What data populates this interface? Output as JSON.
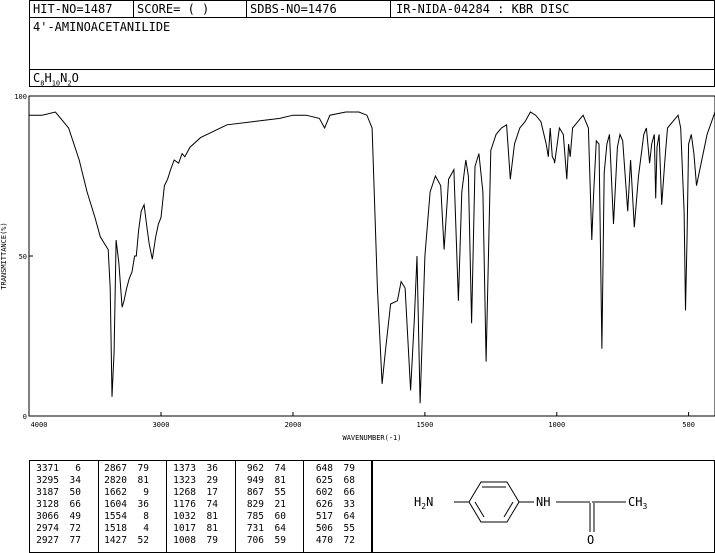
{
  "header": {
    "hit_no": "HIT-NO=1487",
    "score": "SCORE=  (   )",
    "sdbs_no": "SDBS-NO=1476",
    "ir_nida": "IR-NIDA-04284 : KBR DISC",
    "compound_name": "4'-AMINOACETANILIDE",
    "formula": "C8H10N2O"
  },
  "chart_data": {
    "type": "line",
    "title": "",
    "xlabel": "WAVENUMBER(-1)",
    "ylabel": "TRANSMITTANCE(%)",
    "xlim": [
      4000,
      400
    ],
    "ylim": [
      0,
      100
    ],
    "x_ticks": [
      "4000",
      "3000",
      "2000",
      "1500",
      "1000",
      "500"
    ],
    "y_ticks": [
      "100",
      "50",
      "0"
    ],
    "series": [
      {
        "x": [
          4000,
          3900,
          3800,
          3700,
          3620,
          3560,
          3500,
          3460,
          3430,
          3400,
          3385,
          3371,
          3355,
          3340,
          3320,
          3295,
          3280,
          3260,
          3240,
          3220,
          3200,
          3187,
          3170,
          3150,
          3128,
          3110,
          3090,
          3066,
          3040,
          3020,
          3000,
          2974,
          2950,
          2927,
          2900,
          2867,
          2840,
          2820,
          2780,
          2700,
          2600,
          2500,
          2300,
          2100,
          2000,
          1950,
          1900,
          1880,
          1860,
          1800,
          1750,
          1720,
          1700,
          1680,
          1662,
          1650,
          1630,
          1604,
          1590,
          1575,
          1554,
          1540,
          1530,
          1518,
          1500,
          1480,
          1460,
          1440,
          1427,
          1410,
          1390,
          1373,
          1360,
          1345,
          1335,
          1323,
          1310,
          1295,
          1280,
          1268,
          1250,
          1230,
          1210,
          1190,
          1176,
          1160,
          1140,
          1120,
          1100,
          1080,
          1060,
          1040,
          1032,
          1025,
          1017,
          1010,
          1008,
          1000,
          990,
          975,
          962,
          955,
          949,
          940,
          920,
          900,
          880,
          867,
          860,
          850,
          840,
          829,
          820,
          810,
          800,
          785,
          770,
          760,
          750,
          731,
          720,
          706,
          690,
          670,
          660,
          648,
          640,
          630,
          625,
          620,
          612,
          602,
          590,
          580,
          560,
          540,
          530,
          517,
          512,
          506,
          500,
          490,
          480,
          470,
          450,
          430,
          400
        ],
        "y": [
          94,
          94,
          95,
          90,
          80,
          70,
          62,
          56,
          54,
          52,
          40,
          6,
          20,
          55,
          48,
          34,
          36,
          40,
          43,
          45,
          50,
          50,
          58,
          64,
          66,
          60,
          54,
          49,
          56,
          60,
          62,
          72,
          74,
          77,
          80,
          79,
          82,
          81,
          84,
          87,
          89,
          91,
          92,
          93,
          94,
          94,
          93,
          90,
          94,
          95,
          95,
          94,
          90,
          40,
          10,
          20,
          35,
          36,
          42,
          40,
          8,
          30,
          50,
          4,
          50,
          70,
          75,
          72,
          52,
          74,
          77,
          36,
          70,
          80,
          75,
          29,
          78,
          82,
          70,
          17,
          83,
          88,
          90,
          91,
          74,
          85,
          90,
          92,
          95,
          94,
          92,
          85,
          81,
          90,
          81,
          80,
          79,
          84,
          90,
          88,
          74,
          85,
          81,
          90,
          92,
          94,
          90,
          55,
          70,
          86,
          85,
          21,
          76,
          85,
          88,
          60,
          84,
          88,
          86,
          64,
          80,
          59,
          75,
          88,
          90,
          79,
          85,
          88,
          68,
          84,
          88,
          66,
          80,
          90,
          92,
          94,
          90,
          64,
          33,
          55,
          85,
          88,
          82,
          72,
          80,
          88,
          95
        ]
      }
    ]
  },
  "peak_table": {
    "columns": [
      [
        [
          "3371",
          "6"
        ],
        [
          "3295",
          "34"
        ],
        [
          "3187",
          "50"
        ],
        [
          "3128",
          "66"
        ],
        [
          "3066",
          "49"
        ],
        [
          "2974",
          "72"
        ],
        [
          "2927",
          "77"
        ]
      ],
      [
        [
          "2867",
          "79"
        ],
        [
          "2820",
          "81"
        ],
        [
          "1662",
          "9"
        ],
        [
          "1604",
          "36"
        ],
        [
          "1554",
          "8"
        ],
        [
          "1518",
          "4"
        ],
        [
          "1427",
          "52"
        ]
      ],
      [
        [
          "1373",
          "36"
        ],
        [
          "1323",
          "29"
        ],
        [
          "1268",
          "17"
        ],
        [
          "1176",
          "74"
        ],
        [
          "1032",
          "81"
        ],
        [
          "1017",
          "81"
        ],
        [
          "1008",
          "79"
        ]
      ],
      [
        [
          "962",
          "74"
        ],
        [
          "949",
          "81"
        ],
        [
          "867",
          "55"
        ],
        [
          "829",
          "21"
        ],
        [
          "785",
          "60"
        ],
        [
          "731",
          "64"
        ],
        [
          "706",
          "59"
        ]
      ],
      [
        [
          "648",
          "79"
        ],
        [
          "625",
          "68"
        ],
        [
          "602",
          "66"
        ],
        [
          "626",
          "33"
        ],
        [
          "517",
          "64"
        ],
        [
          "506",
          "55"
        ],
        [
          "470",
          "72"
        ]
      ]
    ]
  },
  "structure": {
    "left_group_main": "H",
    "left_group_sub": "2",
    "left_group_atom": "N",
    "nh_label": "NH",
    "methyl_main": "CH",
    "methyl_sub": "3",
    "oxygen_label": "O"
  }
}
